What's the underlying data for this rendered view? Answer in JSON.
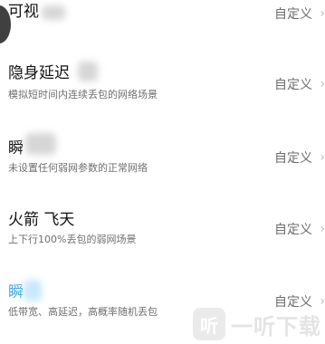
{
  "rows": [
    {
      "title": "可视",
      "description": "",
      "action": "自定义",
      "title_color": "#111111"
    },
    {
      "title": "隐身延迟",
      "description": "模拟短时间内连续丢包的网络场景",
      "action": "自定义",
      "title_color": "#111111"
    },
    {
      "title": "瞬",
      "description": "未设置任何弱网参数的正常网络",
      "action": "自定义",
      "title_color": "#111111"
    },
    {
      "title": "火箭 飞天",
      "description": "上下行100%丢包的弱网场景",
      "action": "自定义",
      "title_color": "#111111"
    },
    {
      "title": "瞬",
      "description": "低带宽、高延迟，高概率随机丢包",
      "action": "自定义",
      "title_color": "#3aa7e8"
    }
  ],
  "watermark": {
    "logo_glyph": "听",
    "text": "一听下载"
  },
  "colors": {
    "accent": "#3aa7e8",
    "action_text": "#6d6d6d",
    "description_text": "#6f6f6f"
  }
}
